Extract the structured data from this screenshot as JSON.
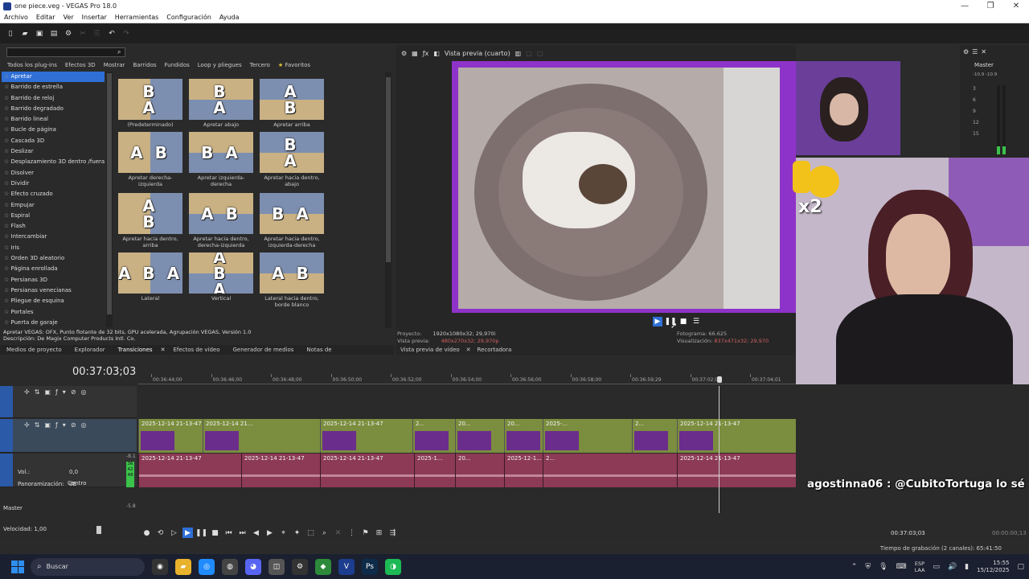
{
  "window": {
    "title": "one piece.veg - VEGAS Pro 18.0",
    "controls": [
      "—",
      "❐",
      "✕"
    ]
  },
  "menu": [
    "Archivo",
    "Editar",
    "Ver",
    "Insertar",
    "Herramientas",
    "Configuración",
    "Ayuda"
  ],
  "transitions": {
    "search_placeholder": "",
    "categories": [
      "Todos los plug-ins",
      "Efectos 3D",
      "Mostrar",
      "Barridos",
      "Fundidos",
      "Loop y pliegues",
      "Tercero",
      "Favoritos"
    ],
    "tree": [
      "Apretar",
      "Barrido de estrella",
      "Barrido de reloj",
      "Barrido degradado",
      "Barrido lineal",
      "Bucle de página",
      "Cascada 3D",
      "Deslizar",
      "Desplazamiento 3D dentro /fuera",
      "Disolver",
      "Dividir",
      "Efecto cruzado",
      "Empujar",
      "Espiral",
      "Flash",
      "Intercambiar",
      "Iris",
      "Orden 3D aleatorio",
      "Página enrollada",
      "Persianas 3D",
      "Persianas venecianas",
      "Pliegue de esquina",
      "Portales",
      "Puerta de garaje"
    ],
    "presets": [
      {
        "label": "(Predeterminado)",
        "glyphs": "B\nA"
      },
      {
        "label": "Apretar abajo",
        "glyphs": "B\nA"
      },
      {
        "label": "Apretar arriba",
        "glyphs": "A\nB"
      },
      {
        "label": "Apretar derecha-izquierda",
        "glyphs": "A B"
      },
      {
        "label": "Apretar izquierda-derecha",
        "glyphs": "B A"
      },
      {
        "label": "Apretar hacia dentro, abajo",
        "glyphs": "B\nA"
      },
      {
        "label": "Apretar hacia dentro, arriba",
        "glyphs": "A\nB"
      },
      {
        "label": "Apretar hacia dentro, derecha-izquierda",
        "glyphs": "A B"
      },
      {
        "label": "Apretar hacia dentro, izquierda-derecha",
        "glyphs": "B A"
      },
      {
        "label": "Lateral",
        "glyphs": "A B A"
      },
      {
        "label": "Vertical",
        "glyphs": "A\nB\nA"
      },
      {
        "label": "Lateral hacia dentro, borde blanco",
        "glyphs": "A B"
      }
    ],
    "description_line1": "Apretar VEGAS: OFX, Punto flotante de 32 bits, GPU acelerada, Agrupación VEGAS, Versión 1.0",
    "description_line2": "Descripción: De Magix Computer Products Intl. Co.",
    "tabs": [
      "Medios de proyecto",
      "Explorador",
      "Transiciones",
      "Efectos de vídeo",
      "Generador de medios",
      "Notas de"
    ]
  },
  "preview": {
    "mode": "Vista previa (cuarto)",
    "project_label": "Proyecto:",
    "project_value": "1920x1080x32; 29,970i",
    "preview_label": "Vista previa:",
    "preview_value": "480x270x32; 29,970p",
    "frame_label": "Fotograma:",
    "frame_value": "66.625",
    "display_label": "Visualización:",
    "display_value": "837x471x32; 29,970",
    "tabs": [
      "Vista previa de vídeo",
      "Recortadora"
    ]
  },
  "master": {
    "label": "Master",
    "peaks": [
      "-10.9",
      "-10.9"
    ],
    "ticks": [
      "3",
      "6",
      "9",
      "12",
      "15"
    ]
  },
  "overlay": {
    "emote_text": "x2",
    "chat": "agostinna06 : @CubitoTortuga lo sé"
  },
  "timeline": {
    "timecode": "00:37:03;03",
    "ruler": [
      "00:36:44;00",
      "00:36:46;00",
      "00:36:48;00",
      "00:36:50;00",
      "00:36:52;00",
      "00:36:54;00",
      "00:36:56;00",
      "00:36:58;00",
      "00:36:59;29",
      "00:37:02;01",
      "00:37:04;01"
    ],
    "video_clips": [
      "2025-12-14 21-13-47",
      "2025-12-14 21...",
      "2025-12-14 21-13-47",
      "2...",
      "20...",
      "20...",
      "2025-...",
      "2...",
      "2025-12-14 21-13-47"
    ],
    "audio_clips": [
      "2025-12-14 21-13-47",
      "2025-12-14 21-13-47",
      "2025-12-14 21-13-47",
      "2025-1...",
      "20...",
      "2025-12-1...",
      "2...",
      "2025-12-14 21-13-47"
    ],
    "vol_label": "Vol.:",
    "vol_value": "0,0 dB",
    "pan_label": "Panoramización:",
    "pan_value": "Centro",
    "vu_value": "-8.1",
    "vu_levels": "36\n42\n48",
    "master_label": "Master",
    "master_value": "-5.8",
    "speed": "Velocidad: 1,00",
    "cursor_time": "00:37:03;03",
    "selection_time": "00:00:00;13"
  },
  "status": "Tiempo de grabación (2 canales): 65:41:50",
  "taskbar": {
    "search": "Buscar",
    "lang": "ESP\nLAA",
    "time": "15:55",
    "date": "15/12/2025"
  },
  "colors": {
    "video_track": "#7b8d3e",
    "audio_track": "#8c3a55",
    "accent": "#2f6fd6"
  }
}
